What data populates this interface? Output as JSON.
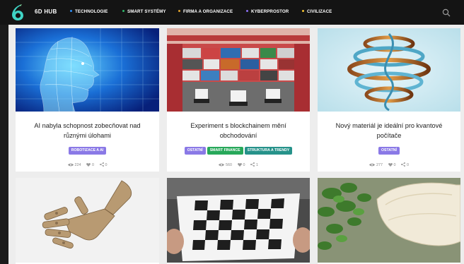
{
  "brand": "6D HUB",
  "nav": [
    {
      "label": "TECHNOLOGIE",
      "dot": "#2f8ef4"
    },
    {
      "label": "SMART SYSTÉMY",
      "dot": "#2fb56a"
    },
    {
      "label": "FIRMA A ORGANIZACE",
      "dot": "#e0a12c"
    },
    {
      "label": "KYBERPROSTOR",
      "dot": "#8a6ef0"
    },
    {
      "label": "CIVILIZACE",
      "dot": "#f2c230"
    }
  ],
  "icons": {
    "logo": "6d-logo-icon",
    "search": "search-icon",
    "views": "eye-icon",
    "likes": "heart-icon",
    "shares": "share-icon"
  },
  "colors": {
    "topbar": "#141414",
    "tag_purple": "#8a79e6",
    "tag_green": "#27a85a",
    "tag_teal": "#26928a"
  },
  "articles": [
    {
      "title_line1": "AI nabyla schopnost zobecňovat nad",
      "title_line2": "různými úlohami",
      "image": "wireframe-human-head",
      "tags": [
        "ROBOTIZACE A AI"
      ],
      "views": "224",
      "likes": "0",
      "shares": "0"
    },
    {
      "title_line1": "Experiment s blockchainem mění",
      "title_line2": "obchodování",
      "image": "container-port-cranes",
      "tags": [
        "OSTATNÍ",
        "SMART FINANCE",
        "STRUKTURA A TRENDY"
      ],
      "views": "560",
      "likes": "0",
      "shares": "1"
    },
    {
      "title_line1": "Nový materiál je ideální pro kvantové",
      "title_line2": "počítače",
      "image": "twisted-ribbon-spiral",
      "tags": [
        "OSTATNÍ"
      ],
      "views": "277",
      "likes": "0",
      "shares": "0"
    },
    {
      "image": "robotic-hand"
    },
    {
      "image": "checkerboard-sheet"
    },
    {
      "image": "stone-and-ivy"
    }
  ]
}
